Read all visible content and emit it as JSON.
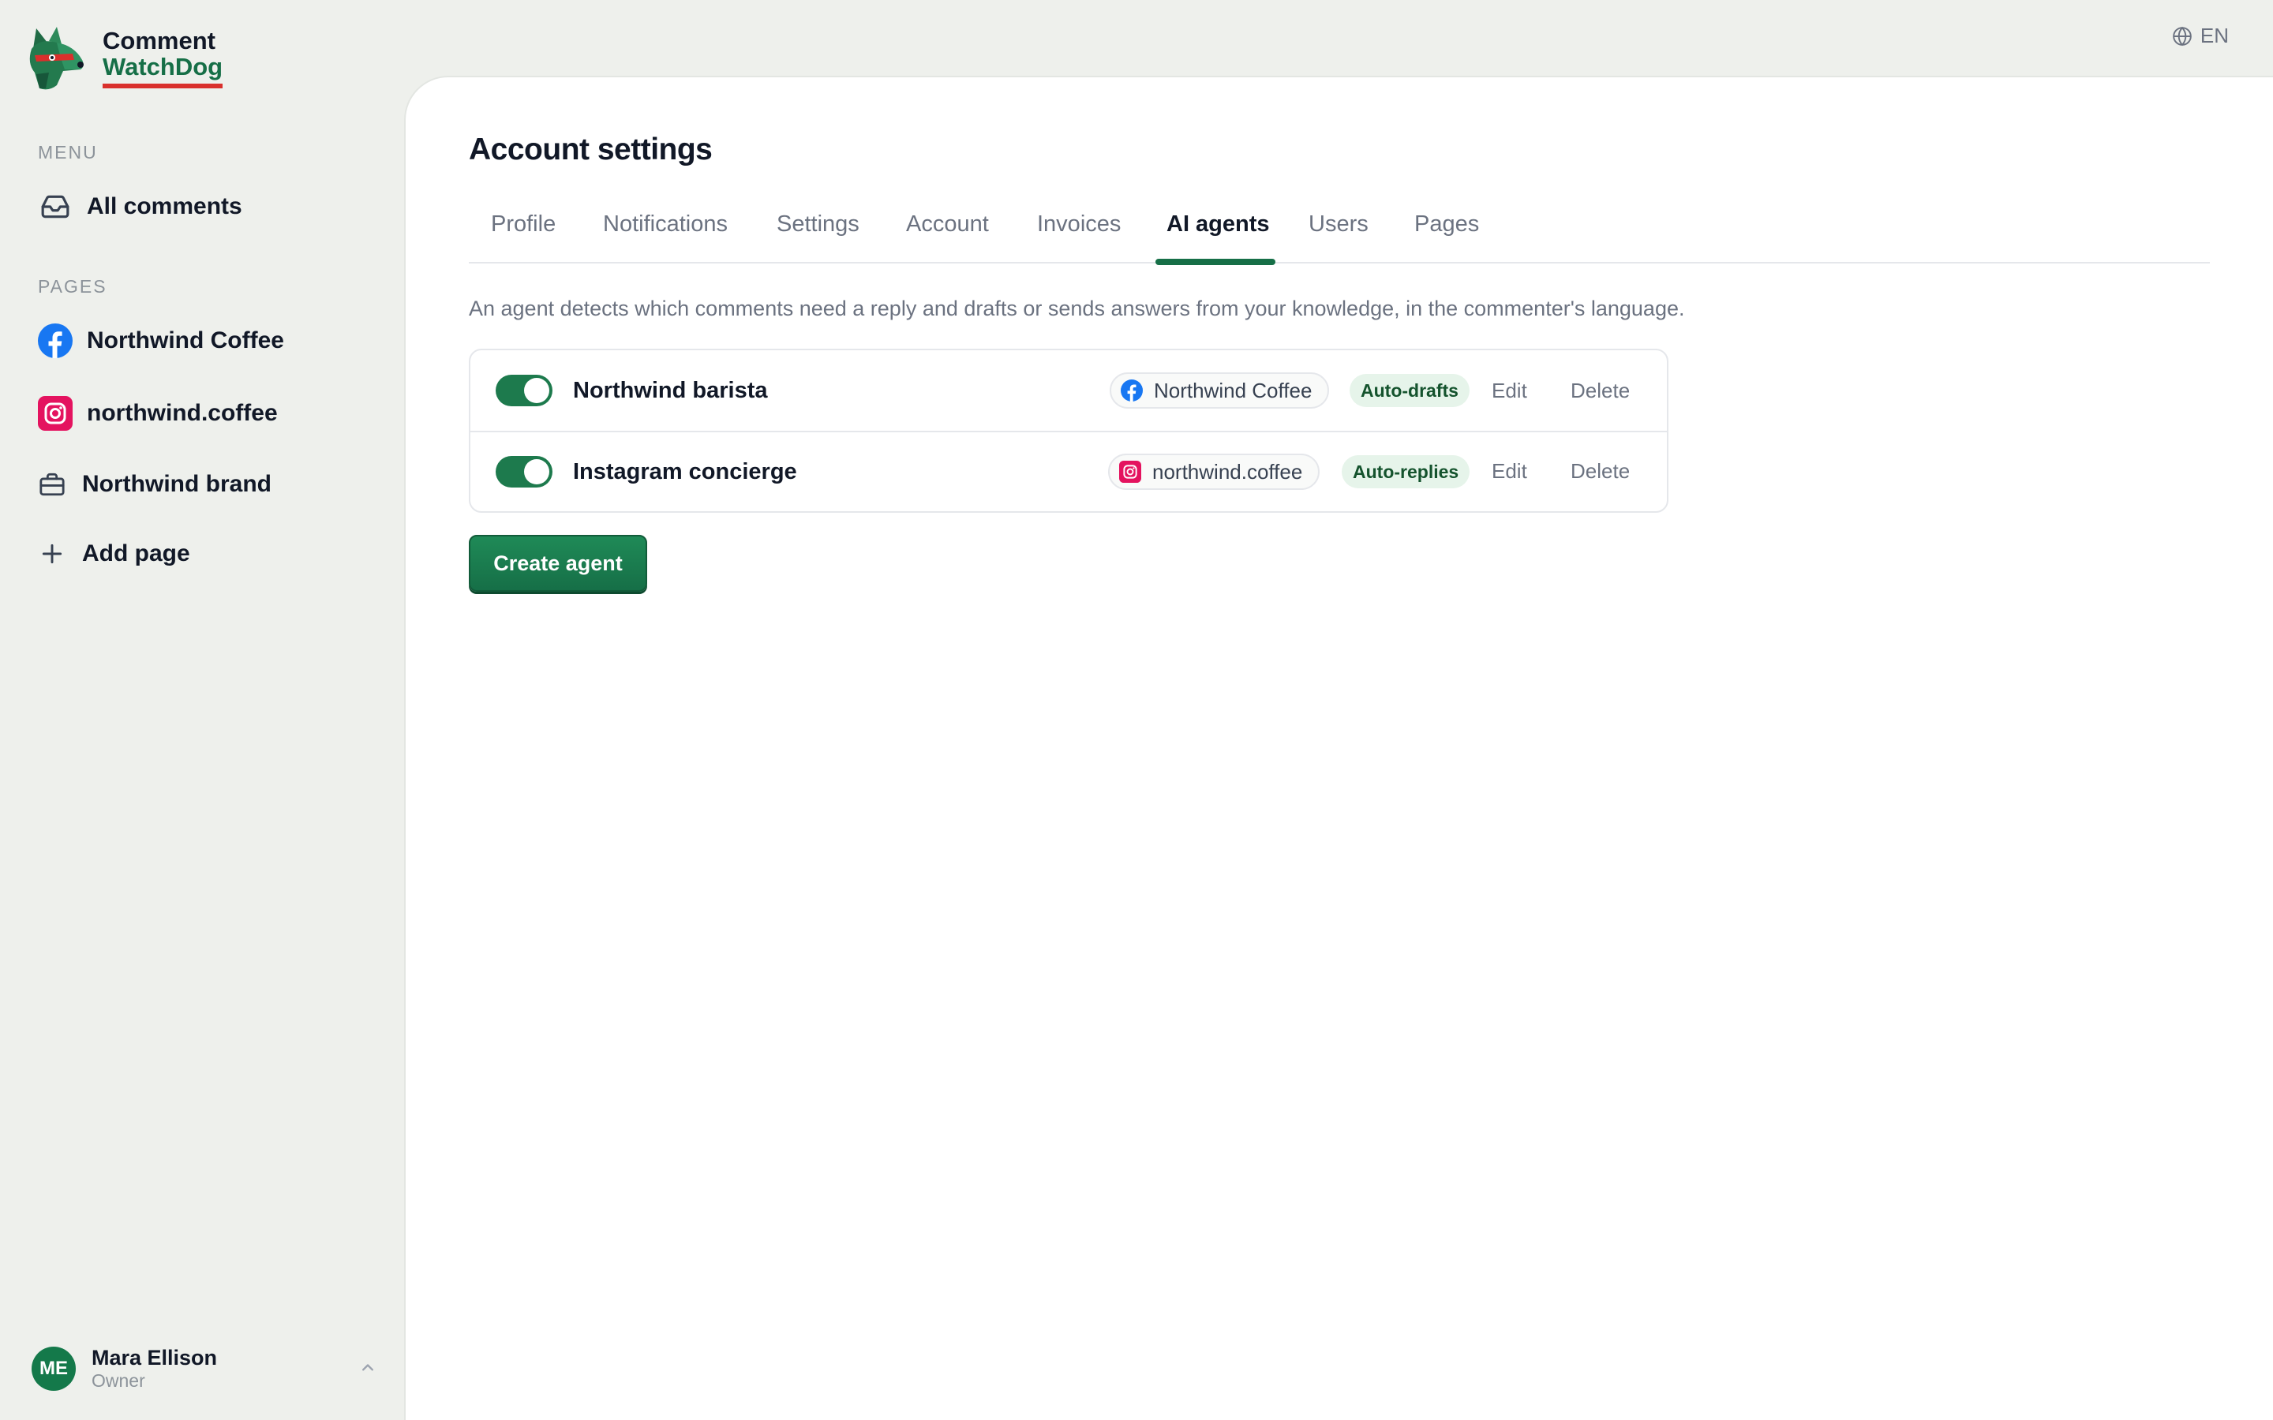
{
  "brand": {
    "line1": "Comment",
    "line2": "WatchDog",
    "accent": "#166f47",
    "underline_color": "#d9302c"
  },
  "sidebar": {
    "menu_label": "MENU",
    "menu_items": [
      {
        "label": "All comments",
        "icon": "inbox-icon"
      }
    ],
    "pages_label": "PAGES",
    "pages": [
      {
        "label": "Northwind Coffee",
        "icon": "facebook-icon"
      },
      {
        "label": "northwind.coffee",
        "icon": "instagram-icon"
      },
      {
        "label": "Northwind brand",
        "icon": "briefcase-icon"
      }
    ],
    "add_page_label": "Add page"
  },
  "user": {
    "initials": "ME",
    "name": "Mara Ellison",
    "role": "Owner"
  },
  "language": {
    "code": "EN",
    "icon": "globe-icon"
  },
  "main": {
    "title": "Account settings",
    "tabs": [
      {
        "label": "Profile"
      },
      {
        "label": "Notifications"
      },
      {
        "label": "Settings"
      },
      {
        "label": "Account"
      },
      {
        "label": "Invoices"
      },
      {
        "label": "AI agents",
        "active": true
      },
      {
        "label": "Users"
      },
      {
        "label": "Pages"
      }
    ],
    "description": "An agent detects which comments need a reply and drafts or sends answers from your knowledge, in the commenter's language.",
    "agents": [
      {
        "enabled": true,
        "name": "Northwind barista",
        "page": "Northwind Coffee",
        "page_icon": "facebook-icon",
        "mode": "Auto-drafts",
        "edit_label": "Edit",
        "delete_label": "Delete"
      },
      {
        "enabled": true,
        "name": "Instagram concierge",
        "page": "northwind.coffee",
        "page_icon": "instagram-icon",
        "mode": "Auto-replies",
        "edit_label": "Edit",
        "delete_label": "Delete"
      }
    ],
    "create_label": "Create agent"
  }
}
